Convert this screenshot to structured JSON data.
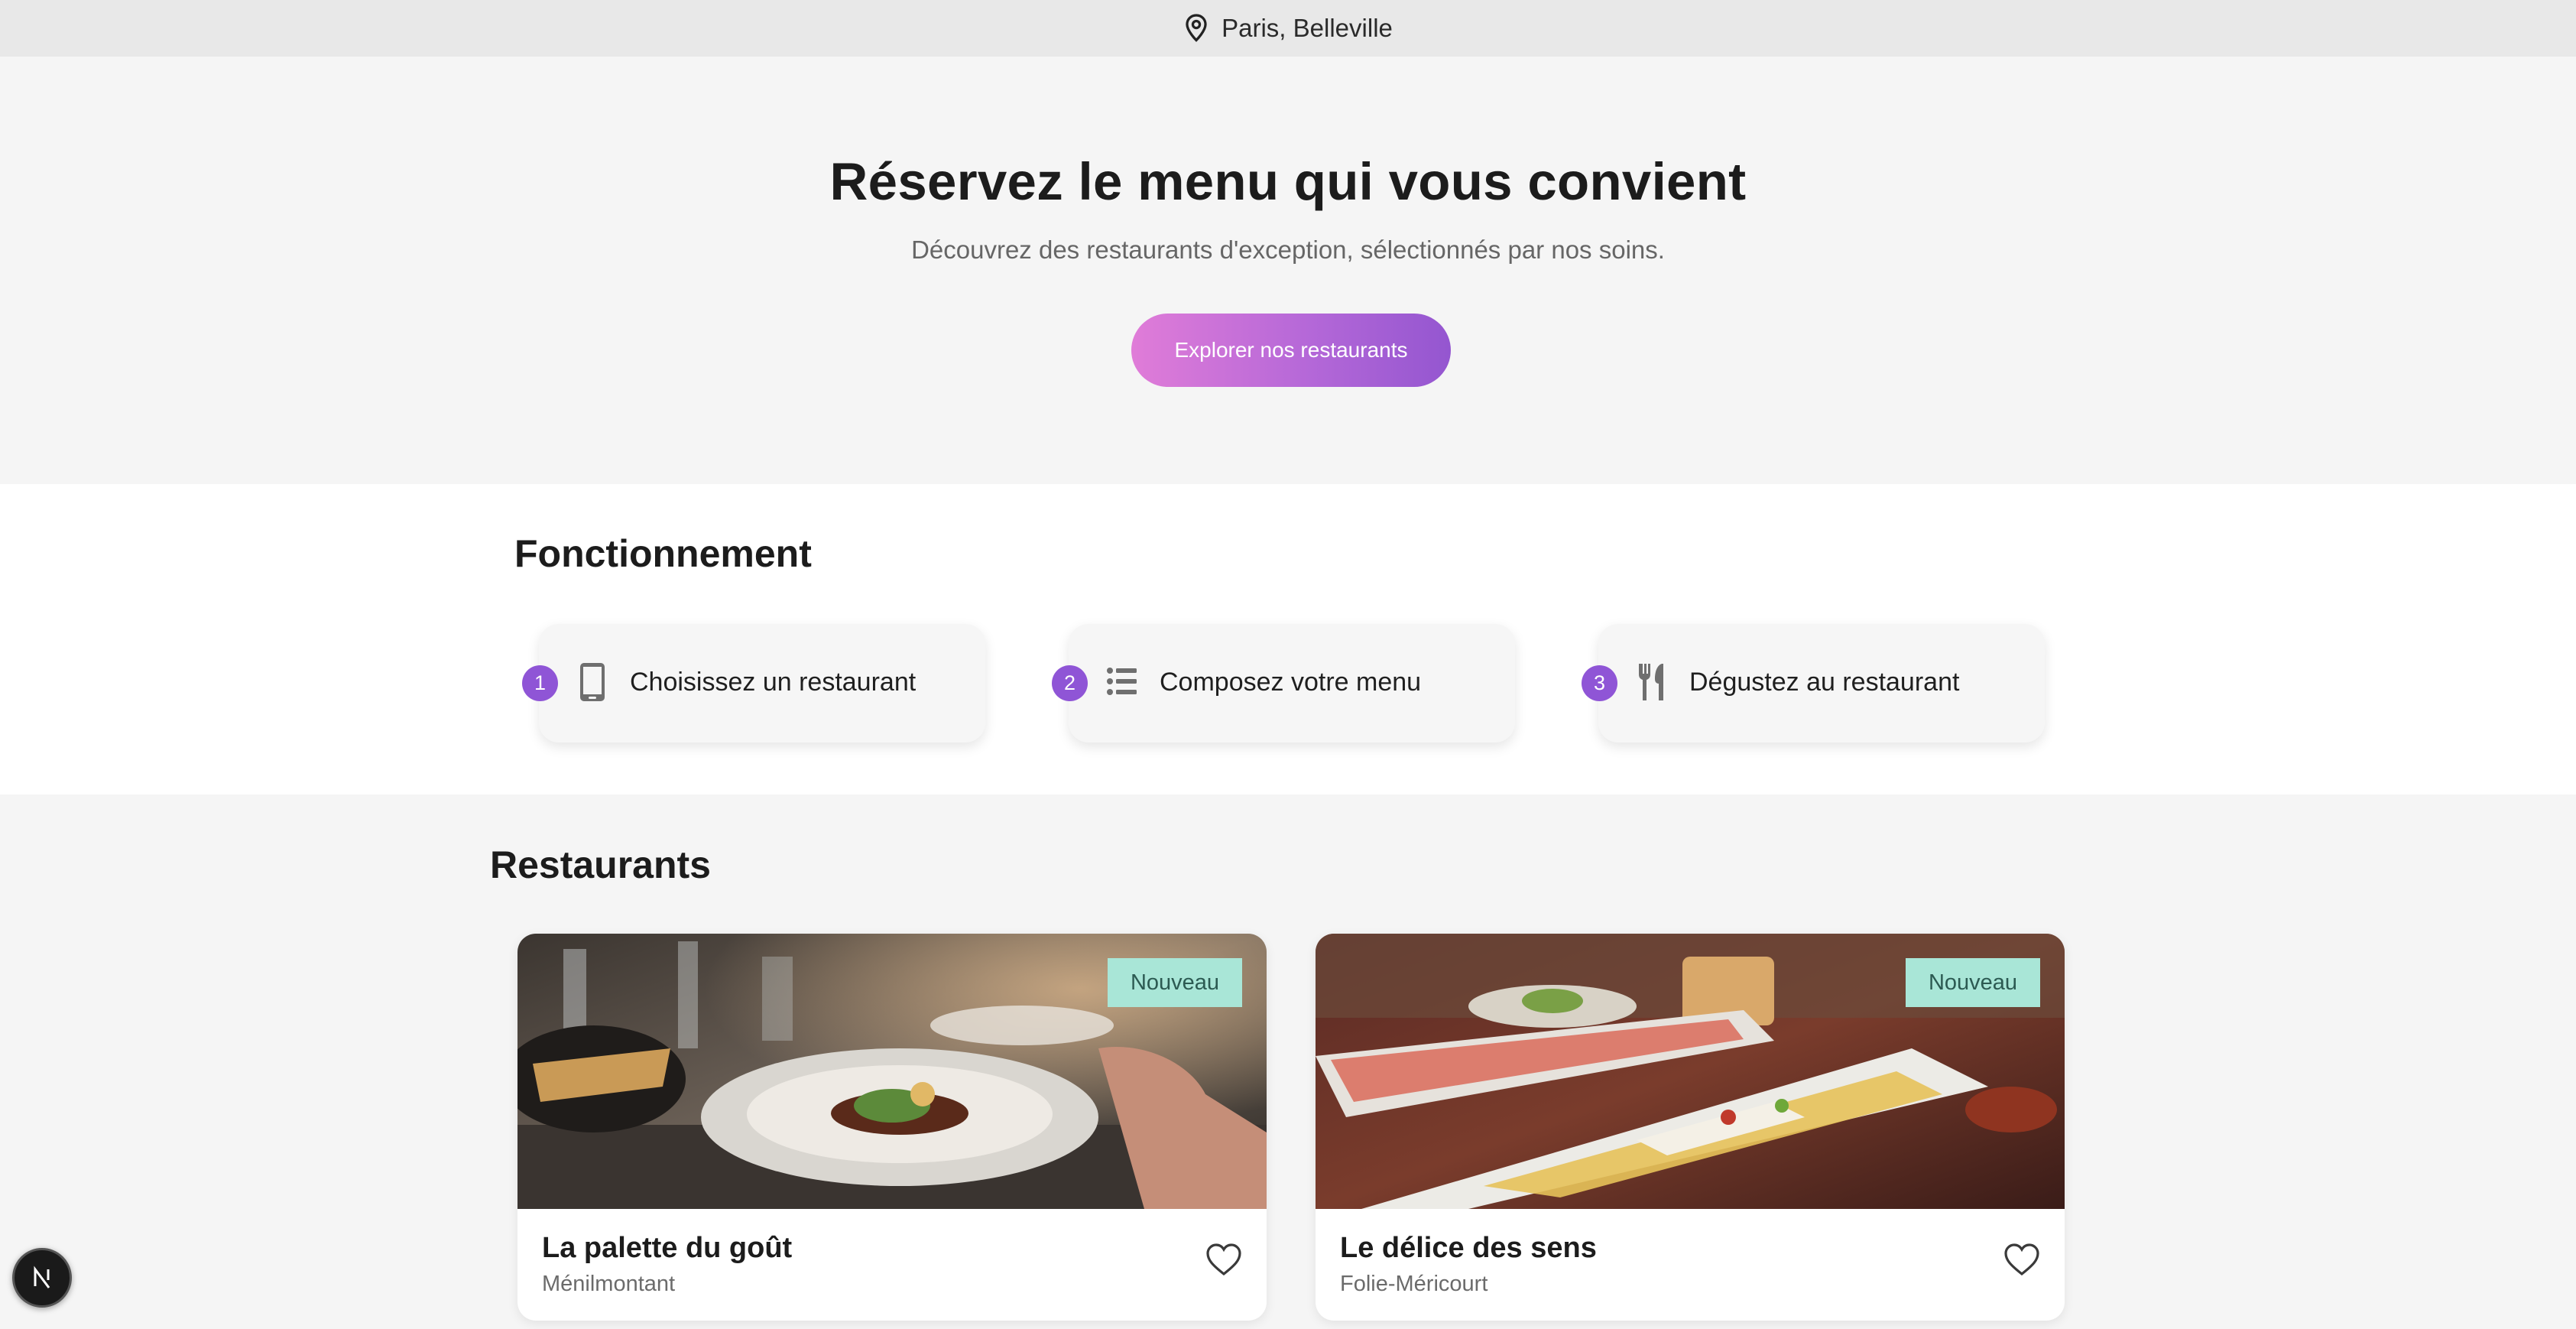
{
  "topbar": {
    "location": "Paris, Belleville",
    "icon": "map-pin-icon"
  },
  "hero": {
    "title": "Réservez le menu qui vous convient",
    "subtitle": "Découvrez des restaurants d'exception, sélectionnés par nos soins.",
    "cta_label": "Explorer nos restaurants"
  },
  "how": {
    "title": "Fonctionnement",
    "steps": [
      {
        "number": "1",
        "icon": "smartphone-icon",
        "label": "Choisissez un restaurant"
      },
      {
        "number": "2",
        "icon": "list-icon",
        "label": "Composez votre menu"
      },
      {
        "number": "3",
        "icon": "fork-knife-icon",
        "label": "Dégustez au restaurant"
      }
    ]
  },
  "restaurants": {
    "title": "Restaurants",
    "items": [
      {
        "name": "La palette du goût",
        "area": "Ménilmontant",
        "badge": "Nouveau"
      },
      {
        "name": "Le délice des sens",
        "area": "Folie-Méricourt",
        "badge": "Nouveau"
      }
    ]
  },
  "colors": {
    "accent": "#8f55d6",
    "badge_bg": "#a9e6d7",
    "cta_start": "#e07cd8",
    "cta_end": "#9456d0"
  }
}
